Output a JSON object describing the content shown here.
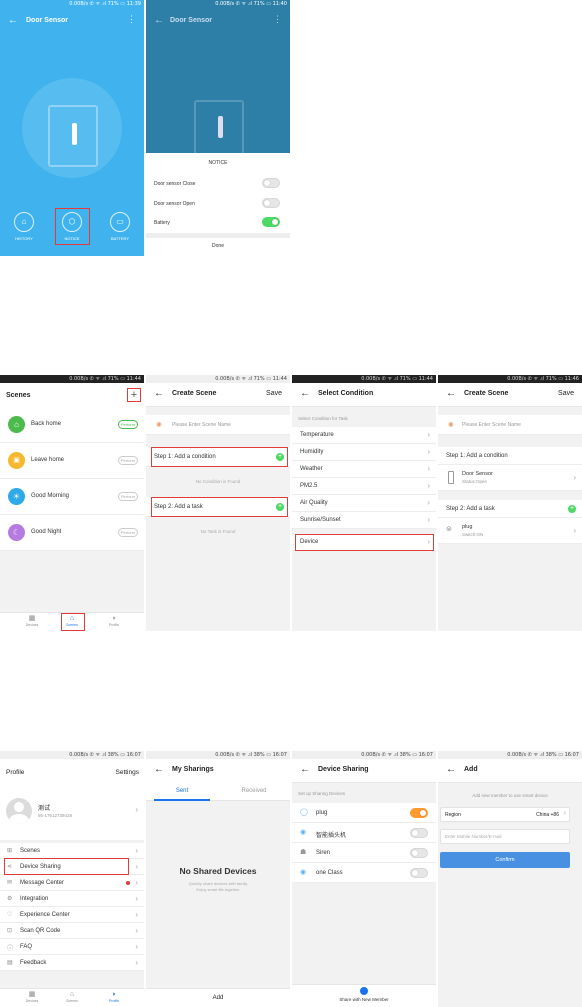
{
  "door": {
    "status_left": "0.00B/s ✆ ᯤ .ıl 71% ▭ 11:39",
    "status_right": "0.00B/s ✆ ᯤ .ıl 71% ▭ 11:40",
    "title": "Door Sensor",
    "btn_history": "HISTORY",
    "btn_notice": "NOTICE",
    "btn_battery": "BATTERY",
    "notice_title": "NOTICE",
    "notice_items": [
      "Door sensor Close",
      "Door sensor Open",
      "Battery"
    ],
    "done": "Done",
    "colors": {
      "blue": "#3fb5f0",
      "toggle_on": "#4cd964",
      "highlight": "#e33a3a"
    }
  },
  "scenes": {
    "status": "0.00B/s ✆ ᯤ .ıl 71% ▭ 11:44",
    "title": "Scenes",
    "plus_icon": "+",
    "items": [
      {
        "label": "Back home",
        "badge": "Perform",
        "color": "#4cba4c"
      },
      {
        "label": "Leave home",
        "badge": "Perform",
        "color": "#f5b82e"
      },
      {
        "label": "Good Morning",
        "badge": "Perform",
        "color": "#2fa9e8"
      },
      {
        "label": "Good Night",
        "badge": "Perform",
        "color": "#b57be0"
      }
    ],
    "tabs": [
      "Devices",
      "Scenes",
      "Profile"
    ]
  },
  "create1": {
    "status": "0.00B/s ✆ ᯤ .ıl 71% ▭ 11:44",
    "title": "Create Scene",
    "save": "Save",
    "name_placeholder": "Please Enter Scene Name",
    "step1": "Step 1: Add a condition",
    "no_condition": "No Condition is Found",
    "step2": "Step 2: Add a task",
    "no_task": "No Task is Found"
  },
  "select": {
    "status": "0.00B/s ✆ ᯤ .ıl 71% ▭ 11:44",
    "title": "Select Condition",
    "subtitle": "Select Condition for Task",
    "items": [
      "Temperature",
      "Humidity",
      "Weather",
      "PM2.5",
      "Air Quality",
      "Sunrise/Sunset",
      "Device"
    ]
  },
  "create2": {
    "status": "0.00B/s ✆ ᯤ .ıl 71% ▭ 11:46",
    "title": "Create Scene",
    "save": "Save",
    "name_placeholder": "Please Enter Scene Name",
    "step1": "Step 1: Add a condition",
    "cond_name": "Door Sensor",
    "cond_status": "Status:Open",
    "step2": "Step 2: Add a task",
    "task_name": "plug",
    "task_status": "Switch:ON"
  },
  "profile": {
    "status": "0.00B/s ✆ ᯤ .ıl 38% ▭ 16:07",
    "title": "Profile",
    "settings": "Settings",
    "user_name": "测试",
    "user_phone": "86-17612739428",
    "menu": [
      "Scenes",
      "Device Sharing",
      "Message Center",
      "Integration",
      "Experience Center",
      "Scan QR Code",
      "FAQ",
      "Feedback"
    ],
    "tabs": [
      "Devices",
      "Scenes",
      "Profile"
    ]
  },
  "sharings": {
    "status": "0.00B/s ✆ ᯤ .ıl 38% ▭ 16:07",
    "title": "My Sharings",
    "tab_sent": "Sent",
    "tab_received": "Received",
    "empty_title": "No Shared Devices",
    "empty_desc1": "Quickly share devices with family",
    "empty_desc2": "Enjoy smart life together",
    "add": "Add"
  },
  "devshare": {
    "status": "0.00B/s ✆ ᯤ .ıl 38% ▭ 16:07",
    "title": "Device Sharing",
    "subtitle": "Set up Sharing Devices",
    "items": [
      "plug",
      "智能插头机",
      "Siren",
      "one Class"
    ],
    "share_btn": "Share with New Member"
  },
  "add": {
    "status": "0.00B/s ✆ ᯤ .ıl 38% ▭ 16:07",
    "title": "Add",
    "hint": "Add new member to use smart device",
    "region_label": "Region",
    "region_value": "China +86",
    "phone_placeholder": "Enter Mobile Number/E-mail",
    "confirm": "Confirm"
  }
}
